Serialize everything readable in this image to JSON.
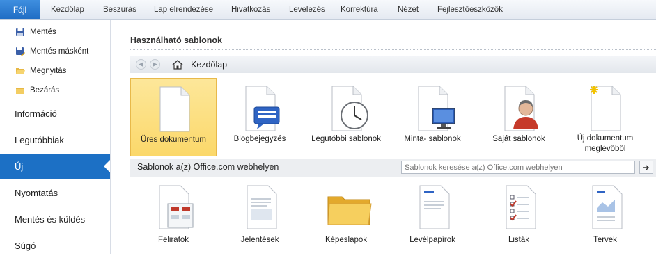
{
  "ribbon": {
    "file_tab": "Fájl",
    "tabs": [
      "Kezdőlap",
      "Beszúrás",
      "Lap elrendezése",
      "Hivatkozás",
      "Levelezés",
      "Korrektúra",
      "Nézet",
      "Fejlesztőeszközök"
    ]
  },
  "backstage": {
    "commands": [
      {
        "label": "Mentés",
        "icon": "save-icon"
      },
      {
        "label": "Mentés másként",
        "icon": "save-as-icon"
      },
      {
        "label": "Megnyitás",
        "icon": "open-folder-icon"
      },
      {
        "label": "Bezárás",
        "icon": "close-folder-icon"
      }
    ],
    "tabs": [
      {
        "label": "Információ"
      },
      {
        "label": "Legutóbbiak"
      },
      {
        "label": "Új",
        "active": true
      },
      {
        "label": "Nyomtatás"
      },
      {
        "label": "Mentés és küldés"
      },
      {
        "label": "Súgó"
      }
    ]
  },
  "content": {
    "title": "Használható sablonok",
    "nav": {
      "home_label": "Kezdőlap"
    },
    "templates": [
      {
        "label": "Üres dokumentum",
        "icon": "blank-document-icon",
        "selected": true
      },
      {
        "label": "Blogbejegyzés",
        "icon": "blog-post-icon"
      },
      {
        "label": "Legutóbbi sablonok",
        "icon": "recent-templates-icon"
      },
      {
        "label": "Minta- sablonok",
        "icon": "sample-templates-icon"
      },
      {
        "label": "Saját sablonok",
        "icon": "my-templates-icon"
      },
      {
        "label": "Új dokumentum",
        "label2": "meglévőből",
        "icon": "new-from-existing-icon"
      }
    ],
    "office": {
      "title": "Sablonok a(z) Office.com webhelyen",
      "search_placeholder": "Sablonok keresése a(z) Office.com webhelyen"
    },
    "office_templates": [
      {
        "label": "Feliratok",
        "icon": "labels-icon"
      },
      {
        "label": "Jelentések",
        "icon": "reports-icon"
      },
      {
        "label": "Képeslapok",
        "icon": "cards-folder-icon"
      },
      {
        "label": "Levélpapírok",
        "icon": "letterhead-icon"
      },
      {
        "label": "Listák",
        "icon": "lists-icon"
      },
      {
        "label": "Tervek",
        "icon": "plans-icon"
      }
    ]
  },
  "colors": {
    "accent": "#1c70c5",
    "selected_tile": "#fbd86a"
  }
}
